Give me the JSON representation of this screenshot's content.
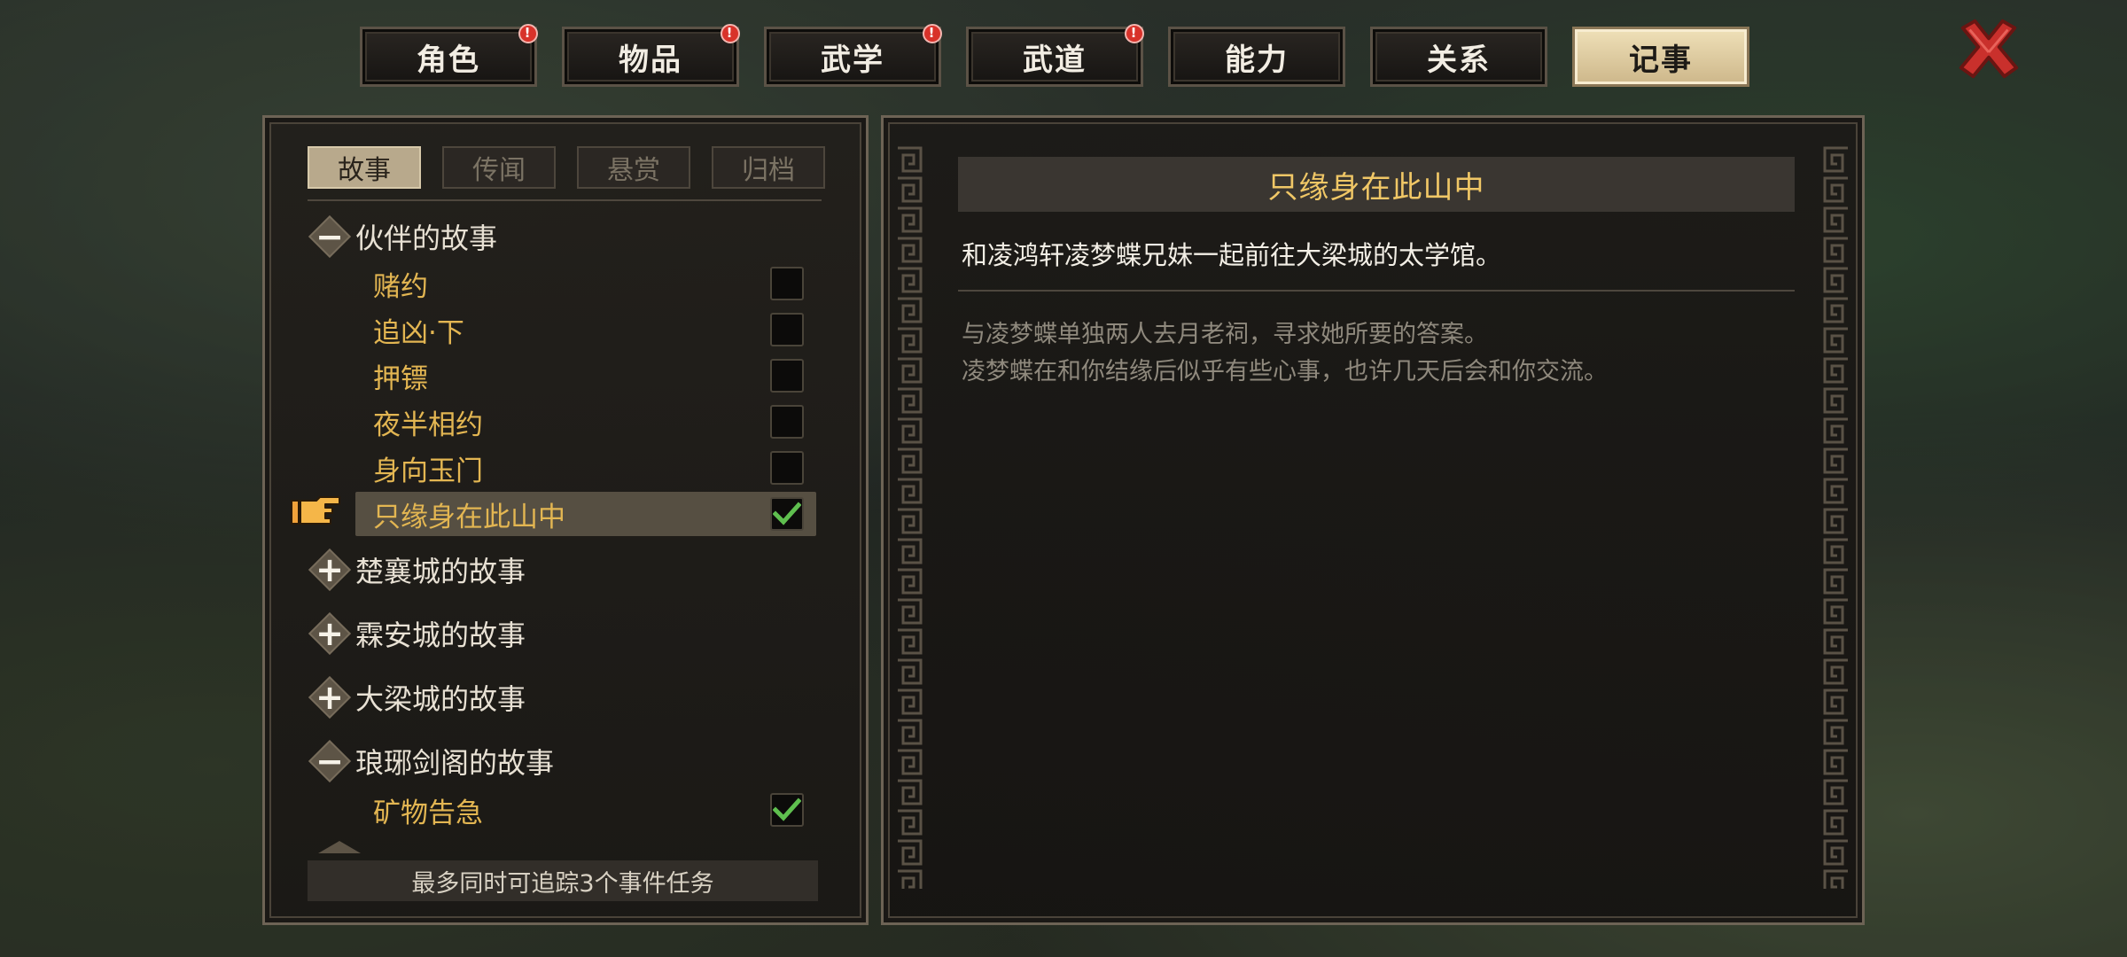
{
  "tabs": [
    {
      "label": "角色",
      "badge": "!"
    },
    {
      "label": "物品",
      "badge": "!"
    },
    {
      "label": "武学",
      "badge": "!"
    },
    {
      "label": "武道",
      "badge": "!"
    },
    {
      "label": "能力",
      "badge": ""
    },
    {
      "label": "关系",
      "badge": ""
    },
    {
      "label": "记事",
      "badge": "",
      "active": true
    }
  ],
  "sub_tabs": [
    "故事",
    "传闻",
    "悬赏",
    "归档"
  ],
  "groups": {
    "partners": {
      "label": "伙伴的故事",
      "state": "expanded"
    },
    "chuxiang": {
      "label": "楚襄城的故事",
      "state": "collapsed"
    },
    "linan": {
      "label": "霖安城的故事",
      "state": "collapsed"
    },
    "daliang": {
      "label": "大梁城的故事",
      "state": "collapsed"
    },
    "langya": {
      "label": "琅琊剑阁的故事",
      "state": "expanded"
    }
  },
  "partner_items": [
    {
      "label": "赌约",
      "checked": false
    },
    {
      "label": "追凶·下",
      "checked": false
    },
    {
      "label": "押镖",
      "checked": false
    },
    {
      "label": "夜半相约",
      "checked": false
    },
    {
      "label": "身向玉门",
      "checked": false
    },
    {
      "label": "只缘身在此山中",
      "checked": true,
      "selected": true
    }
  ],
  "langya_items": [
    {
      "label": "矿物告急",
      "checked": true
    }
  ],
  "footer_note": "最多同时可追踪3个事件任务",
  "detail": {
    "title": "只缘身在此山中",
    "summary": "和凌鸿轩凌梦蝶兄妹一起前往大梁城的太学馆。",
    "lines": [
      "与凌梦蝶单独两人去月老祠，寻求她所要的答案。",
      "凌梦蝶在和你结缘后似乎有些心事，也许几天后会和你交流。"
    ]
  },
  "colors": {
    "accent_gold": "#e3b652",
    "title_gold": "#f0c766",
    "badge_red": "#d8322a",
    "check_green": "#5fbf4f",
    "close_red": "#c9302c"
  }
}
